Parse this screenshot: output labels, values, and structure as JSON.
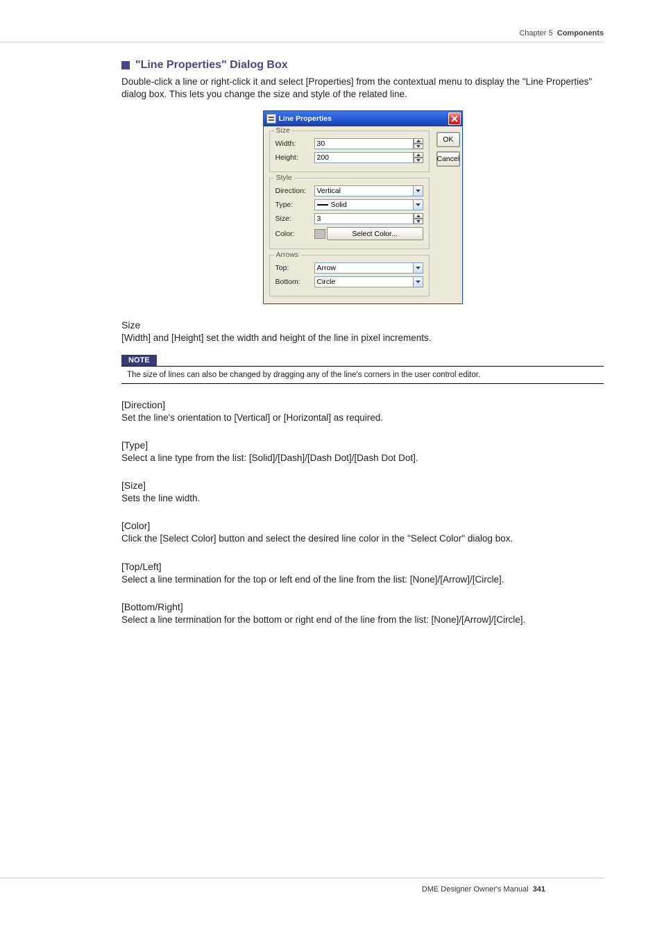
{
  "header": {
    "chapter": "Chapter 5",
    "section": "Components"
  },
  "title": "\"Line Properties\" Dialog Box",
  "intro": "Double-click a line or right-click it and select [Properties] from the contextual menu to display the \"Line Properties\" dialog box. This lets you change the size and style of the related line.",
  "dialog": {
    "title": "Line Properties",
    "ok": "OK",
    "cancel": "Cancel",
    "groups": {
      "size": {
        "legend": "Size",
        "width_label": "Width:",
        "width_value": "30",
        "height_label": "Height:",
        "height_value": "200"
      },
      "style": {
        "legend": "Style",
        "direction_label": "Direction:",
        "direction_value": "Vertical",
        "type_label": "Type:",
        "type_value": "Solid",
        "size_label": "Size:",
        "size_value": "3",
        "color_label": "Color:",
        "color_btn": "Select Color..."
      },
      "arrows": {
        "legend": "Arrows",
        "top_label": "Top:",
        "top_value": "Arrow",
        "bottom_label": "Bottom:",
        "bottom_value": "Circle"
      }
    }
  },
  "sections": {
    "size_h": "Size",
    "size_t": "[Width] and [Height] set the width and height of the line in pixel increments.",
    "note_label": "NOTE",
    "note_text": "The size of lines can also be changed by dragging any of the line's corners in the user control editor.",
    "direction_h": "[Direction]",
    "direction_t": "Set the line's orientation to [Vertical] or [Horizontal] as required.",
    "type_h": "[Type]",
    "type_t": "Select a line type from the list: [Solid]/[Dash]/[Dash Dot]/[Dash Dot Dot].",
    "ssize_h": "[Size]",
    "ssize_t": "Sets the line width.",
    "color_h": "[Color]",
    "color_t": "Click the [Select Color] button and select the desired line color in the \"Select Color\" dialog box.",
    "top_h": "[Top/Left]",
    "top_t": "Select a line termination for the top or left end of the line from the list: [None]/[Arrow]/[Circle].",
    "bottom_h": "[Bottom/Right]",
    "bottom_t": "Select a line termination for the bottom or right end of the line from the list: [None]/[Arrow]/[Circle]."
  },
  "footer": {
    "text": "DME Designer Owner's Manual",
    "page": "341"
  }
}
